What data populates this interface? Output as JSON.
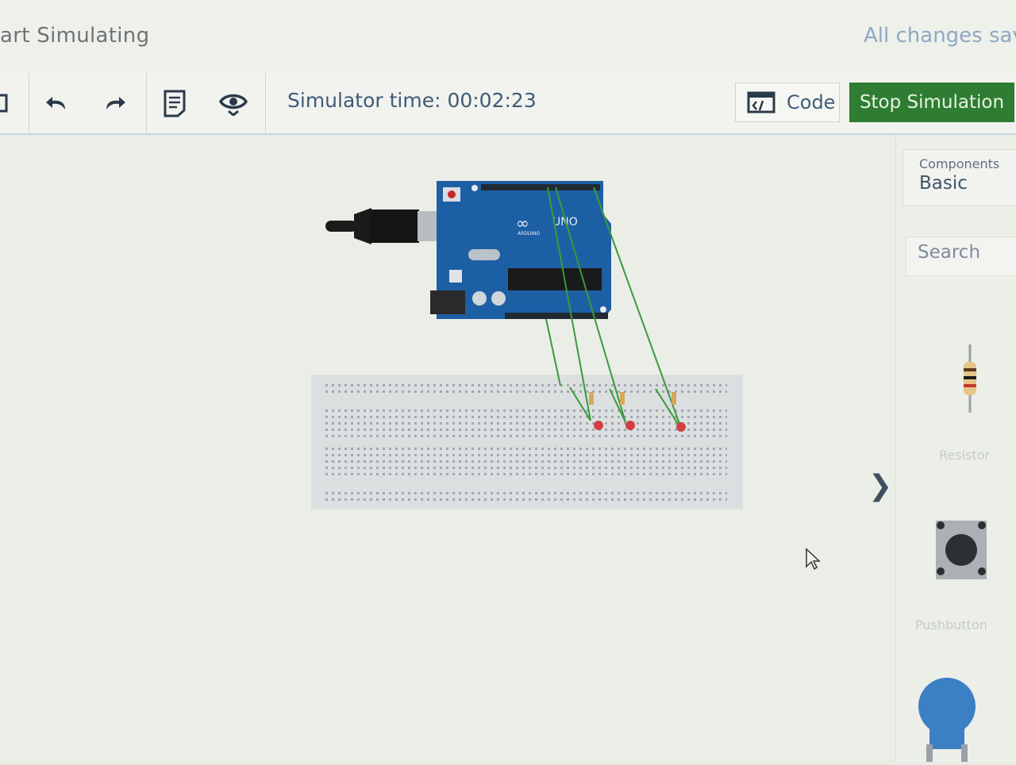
{
  "header": {
    "title": "art Simulating",
    "save_status": "All changes sav"
  },
  "toolbar": {
    "sim_time_label": "Simulator time: 00:02:23",
    "code_label": "Code",
    "stop_label": "Stop Simulation",
    "icons": [
      "new-icon",
      "undo-icon",
      "redo-icon",
      "notes-icon",
      "view-icon",
      "code-icon"
    ]
  },
  "sidebar": {
    "components_label": "Components",
    "components_value": "Basic",
    "search_placeholder": "Search",
    "parts": [
      {
        "name": "Resistor",
        "icon": "resistor-icon"
      },
      {
        "name": "Pushbutton",
        "icon": "pushbutton-icon"
      },
      {
        "name": "",
        "icon": "potentiometer-icon"
      }
    ]
  },
  "canvas": {
    "board_logo": "UNO",
    "board_brand": "ARDUINO"
  },
  "colors": {
    "stop_button": "#2e7d32",
    "board": "#1d5fa5",
    "wire": "#3a9a3a",
    "led": "#d04040"
  }
}
